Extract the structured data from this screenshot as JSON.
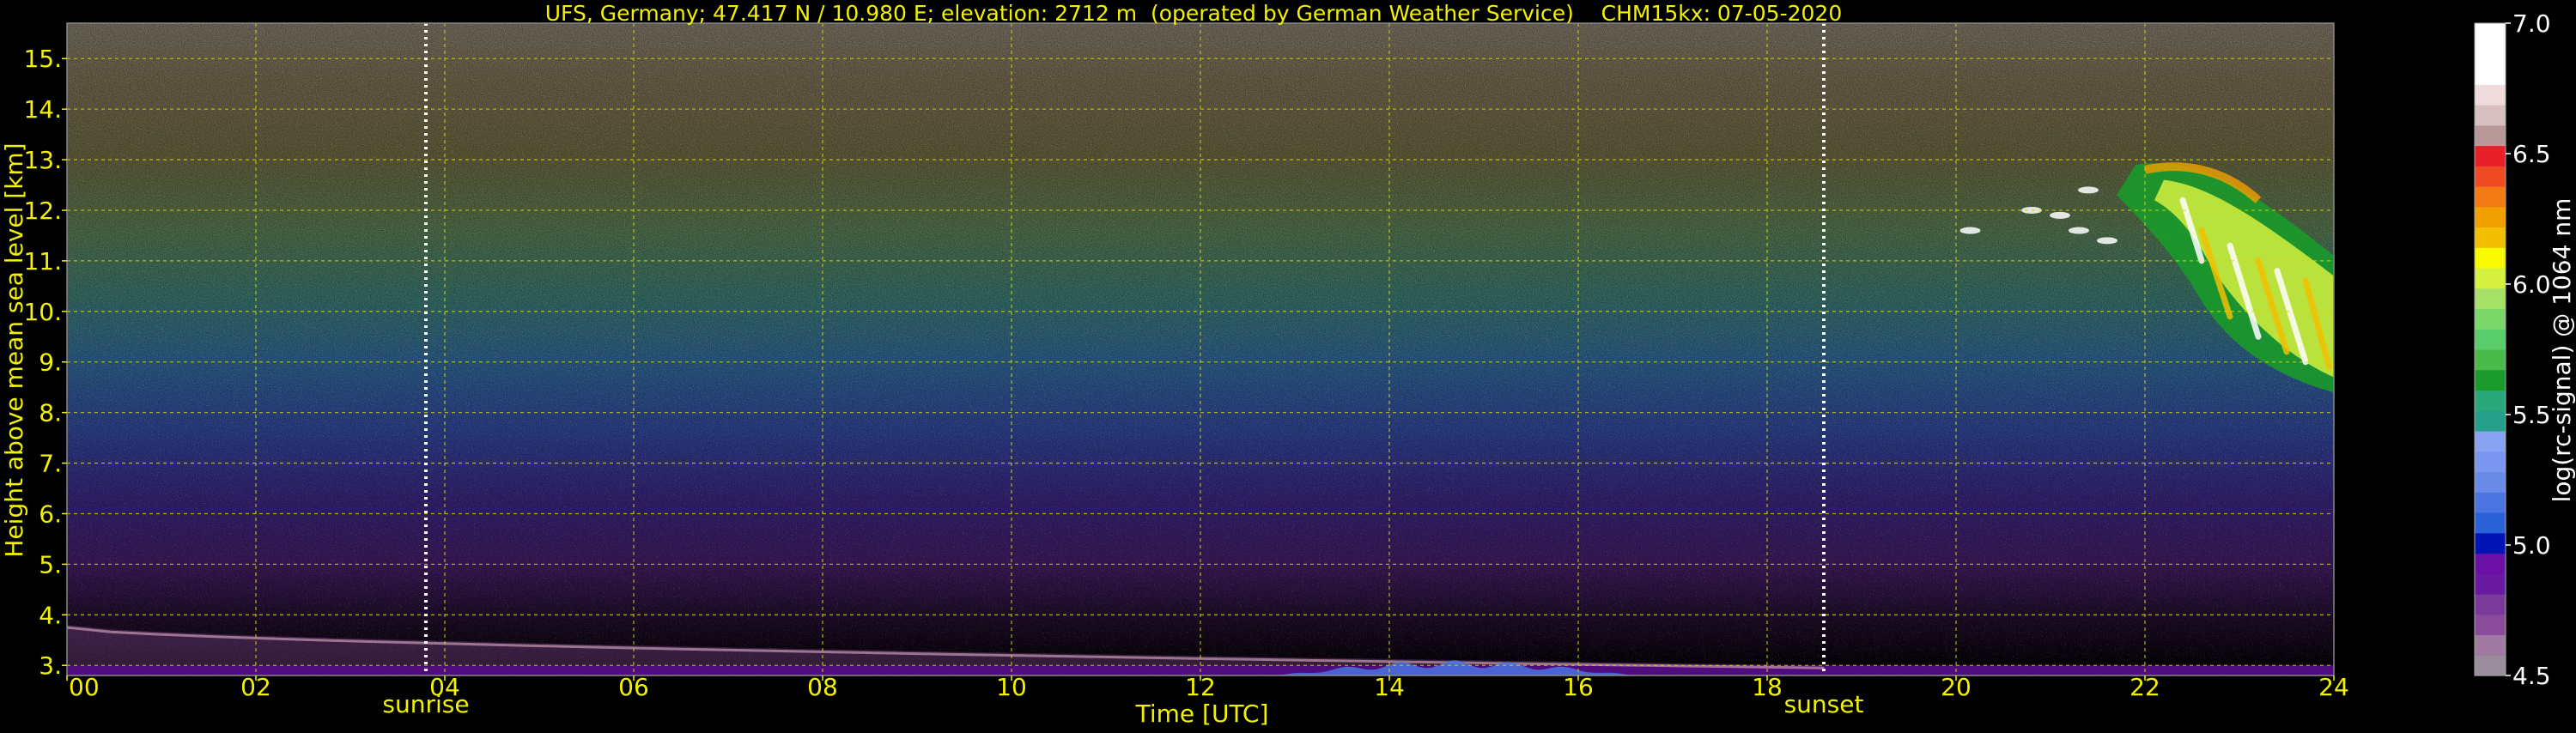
{
  "chart_data": {
    "type": "heatmap",
    "title": "UFS, Germany; 47.417 N / 10.980 E; elevation: 2712 m  (operated by German Weather Service)    CHM15kx: 07-05-2020",
    "xlabel": "Time [UTC]",
    "ylabel": "Height above mean sea level [km]",
    "xlim": [
      0,
      24
    ],
    "ylim": [
      2.8,
      15.7
    ],
    "x_ticks": [
      "00",
      "02",
      "04",
      "06",
      "08",
      "10",
      "12",
      "14",
      "16",
      "18",
      "20",
      "22",
      "24"
    ],
    "y_ticks": [
      "3.",
      "4.",
      "5.",
      "6.",
      "7.",
      "8.",
      "9.",
      "10.",
      "11.",
      "12.",
      "13.",
      "14.",
      "15."
    ],
    "grid": true,
    "markers": [
      {
        "label": "sunrise",
        "x": 3.8
      },
      {
        "label": "sunset",
        "x": 18.6
      }
    ],
    "colorbar": {
      "label": "log(rc-signal) @ 1064 nm",
      "range": [
        4.5,
        7.0
      ],
      "ticks": [
        "4.5",
        "5.0",
        "5.5",
        "6.0",
        "6.5",
        "7.0"
      ],
      "colors": [
        "#9a8c9a",
        "#a07aa0",
        "#8a4c9a",
        "#7a3a9a",
        "#6a1aa0",
        "#6a10a6",
        "#0014b4",
        "#2a62d8",
        "#4a74e0",
        "#6a8ae8",
        "#7a96ee",
        "#8aa2f2",
        "#24a08a",
        "#2aa87a",
        "#1a9a2a",
        "#4aba4a",
        "#5acc6a",
        "#7ad86a",
        "#a6e066",
        "#d6f040",
        "#fafa00",
        "#f2c000",
        "#f2a000",
        "#f27a14",
        "#ee4a24",
        "#e8202a",
        "#b89898",
        "#d8c0c0",
        "#eedcdc",
        "#ffffff",
        "#ffffff",
        "#ffffff"
      ]
    },
    "features": [
      {
        "name": "surface-layer",
        "x_range": [
          0,
          24
        ],
        "height_km": [
          2.8,
          3.0
        ],
        "level": 4.9
      },
      {
        "name": "aerosol-layer",
        "x_range": [
          0,
          18.6
        ],
        "height_km": [
          3.0,
          3.8
        ],
        "level": 4.7
      },
      {
        "name": "afternoon-boundary-layer",
        "x_range": [
          12.8,
          16.6
        ],
        "height_km": [
          2.8,
          3.1
        ],
        "level": 5.15
      },
      {
        "name": "cirrus-cloud",
        "x_range": [
          20.1,
          24
        ],
        "height_km": [
          8.4,
          13.0
        ],
        "level": 6.0
      }
    ]
  }
}
